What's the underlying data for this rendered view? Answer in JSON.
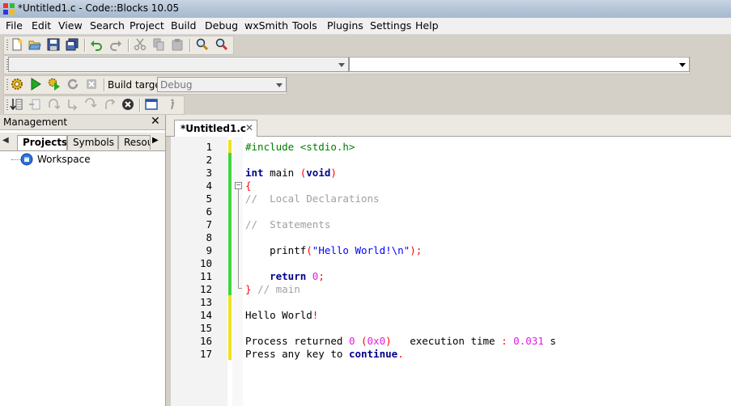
{
  "window": {
    "title": "*Untitled1.c - Code::Blocks 10.05"
  },
  "menu": [
    "File",
    "Edit",
    "View",
    "Search",
    "Project",
    "Build",
    "Debug",
    "wxSmith",
    "Tools",
    "Plugins",
    "Settings",
    "Help"
  ],
  "toolbar": {
    "build_target_label": "Build target:",
    "build_target_value": "Debug"
  },
  "management": {
    "title": "Management",
    "tabs": [
      "Projects",
      "Symbols",
      "Resou"
    ],
    "tree_root": "Workspace"
  },
  "editor": {
    "tab_label": "*Untitled1.c",
    "line_numbers": [
      "1",
      "2",
      "3",
      "4",
      "5",
      "6",
      "7",
      "8",
      "9",
      "10",
      "11",
      "12",
      "13",
      "14",
      "15",
      "16",
      "17"
    ],
    "lines": [
      "#include <stdio.h>",
      "",
      "int main (void)",
      "{",
      "//  Local Declarations",
      "",
      "//  Statements",
      "",
      "    printf(\"Hello World!\\n\");",
      "",
      "    return 0;",
      "} // main",
      "",
      "Hello World!",
      "",
      "Process returned 0 (0x0)   execution time : 0.031 s",
      "Press any key to continue."
    ]
  },
  "colors": {
    "changed_saved": "#3cd63c",
    "changed_unsaved": "#f0e020",
    "keyword": "#00008b",
    "comment": "#a0a0a0",
    "number": "#e01fe0",
    "string": "#0000ff"
  }
}
